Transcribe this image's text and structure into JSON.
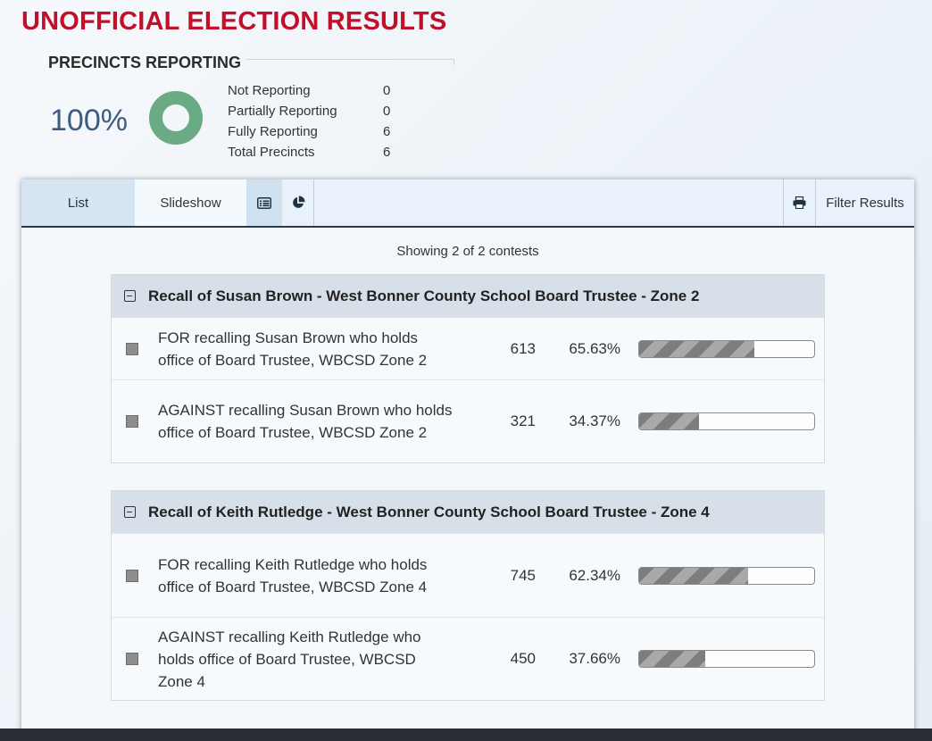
{
  "page": {
    "title": "UNOFFICIAL ELECTION RESULTS"
  },
  "precincts": {
    "heading": "PRECINCTS REPORTING",
    "percent": "100%",
    "rows": [
      {
        "label": "Not Reporting",
        "value": "0"
      },
      {
        "label": "Partially Reporting",
        "value": "0"
      },
      {
        "label": "Fully Reporting",
        "value": "6"
      },
      {
        "label": "Total Precincts",
        "value": "6"
      }
    ],
    "donut_color": "#6aab84"
  },
  "tabs": {
    "list": "List",
    "slideshow": "Slideshow",
    "list_view_icon": "list-view-icon",
    "chart_view_icon": "pie-chart-icon",
    "print_icon": "print-icon",
    "filter": "Filter Results"
  },
  "showing": "Showing 2 of 2 contests",
  "contests": [
    {
      "title": "Recall of Susan Brown - West Bonner County School Board Trustee - Zone 2",
      "choices": [
        {
          "name": "FOR recalling Susan Brown who holds office of Board Trustee, WBCSD Zone 2",
          "votes": "613",
          "percent": "65.63%",
          "fraction": 0.6563
        },
        {
          "name": "AGAINST recalling Susan Brown who holds office of Board Trustee, WBCSD Zone 2",
          "votes": "321",
          "percent": "34.37%",
          "fraction": 0.3437
        }
      ]
    },
    {
      "title": "Recall of Keith Rutledge - West Bonner County School Board Trustee - Zone 4",
      "choices": [
        {
          "name": "FOR recalling Keith Rutledge who holds office of Board Trustee, WBCSD Zone 4",
          "votes": "745",
          "percent": "62.34%",
          "fraction": 0.6234
        },
        {
          "name": "AGAINST recalling Keith Rutledge who holds office of Board Trustee, WBCSD Zone 4",
          "votes": "450",
          "percent": "37.66%",
          "fraction": 0.3766
        }
      ]
    }
  ],
  "colors": {
    "title": "#c0102a",
    "percent_text": "#3d5a80"
  }
}
